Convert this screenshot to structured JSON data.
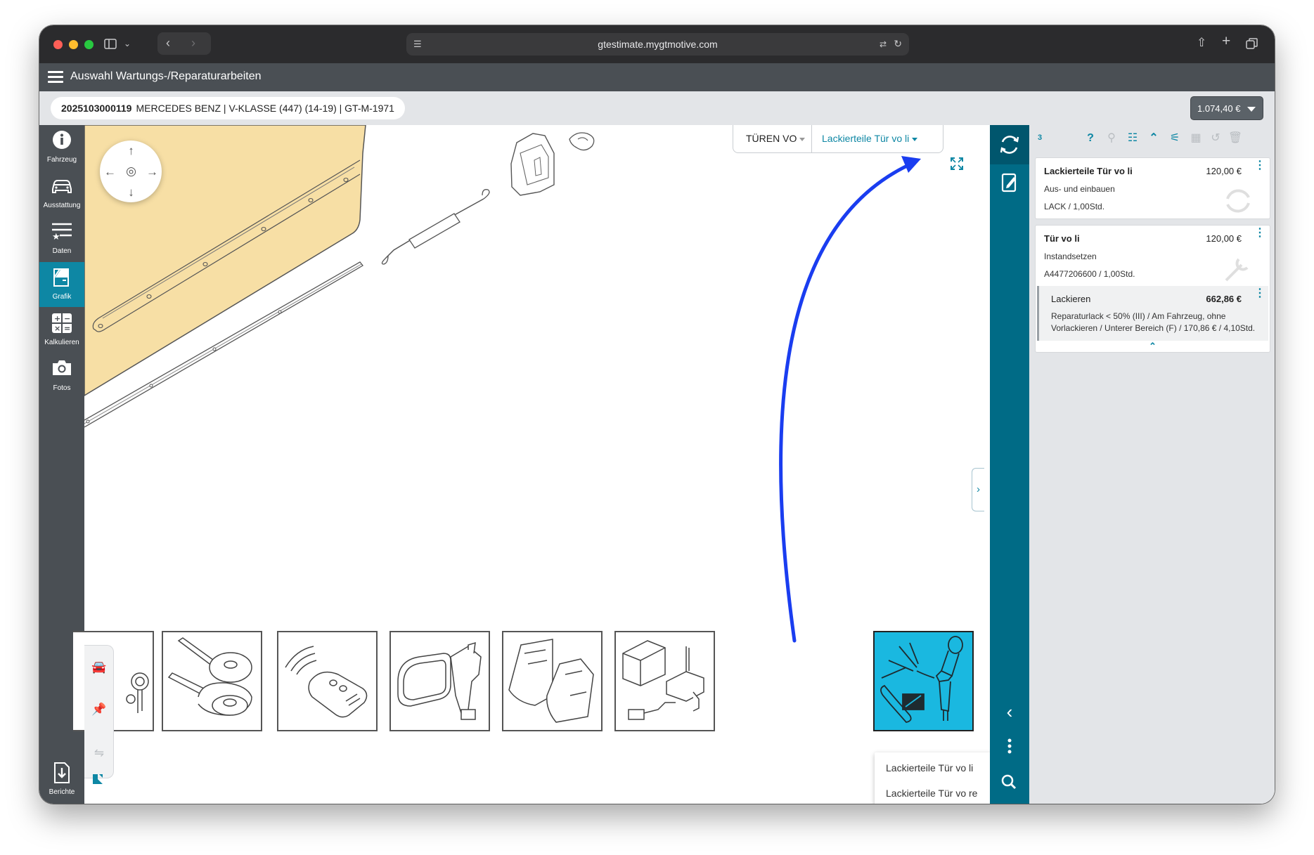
{
  "browser": {
    "url": "gtestimate.mygtmotive.com"
  },
  "app": {
    "title": "Auswahl Wartungs-/Reparaturarbeiten"
  },
  "vehicle": {
    "id": "2025103000119",
    "description": "MERCEDES BENZ | V-KLASSE (447) (14-19) | GT-M-1971",
    "total": "1.074,40 €"
  },
  "sidebar": {
    "items": [
      {
        "label": "Fahrzeug",
        "icon": "info-icon"
      },
      {
        "label": "Ausstattung",
        "icon": "car-icon"
      },
      {
        "label": "Daten",
        "icon": "list-star-icon"
      },
      {
        "label": "Grafik",
        "icon": "door-icon",
        "active": true
      },
      {
        "label": "Kalkulieren",
        "icon": "calculator-icon"
      },
      {
        "label": "Fotos",
        "icon": "camera-icon"
      }
    ],
    "reports_label": "Berichte"
  },
  "graphic": {
    "group_select": "TÜREN VO",
    "part_select": "Lackierteile Tür vo li",
    "thumbnails": [
      {
        "name": "lock-cylinder"
      },
      {
        "name": "key-blanks"
      },
      {
        "name": "remote-key"
      },
      {
        "name": "side-mirror"
      },
      {
        "name": "window-glass"
      },
      {
        "name": "control-unit"
      },
      {
        "name": "paint-parts",
        "selected": true
      }
    ],
    "popup_options": [
      "Lackierteile Tür vo li",
      "Lackierteile Tür vo re"
    ]
  },
  "panel": {
    "count": "3",
    "positions": [
      {
        "title": "Lackierteile Tür vo li",
        "price": "120,00 €",
        "operation": "Aus- und einbauen",
        "detail": "LACK / 1,00Std."
      },
      {
        "title": "Tür vo li",
        "price": "120,00 €",
        "operation": "Instandsetzen",
        "detail": "A4477206600 / 1,00Std.",
        "sub": {
          "title": "Lackieren",
          "price": "662,86 €",
          "detail": "Reparaturlack < 50% (III) / Am Fahrzeug, ohne Vorlackieren / Unterer Bereich (F) / 170,86 € / 4,10Std."
        }
      }
    ]
  },
  "colors": {
    "accent": "#0e87a4",
    "dark_strip": "#006b86",
    "selected_thumb": "#1ab8e0",
    "annotation_arrow": "#1a3df0",
    "door_panel": "#f7dfa5"
  }
}
